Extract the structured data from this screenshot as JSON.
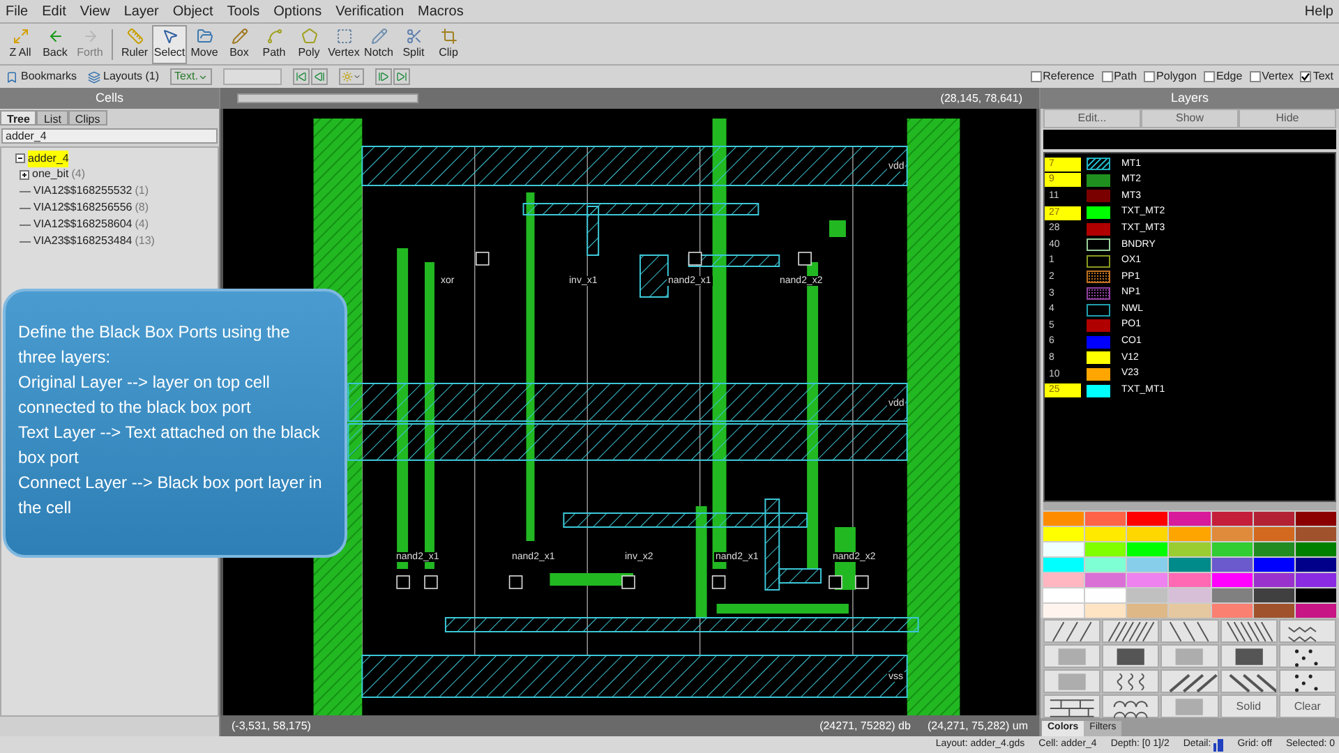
{
  "menu": [
    {
      "label": "File"
    },
    {
      "label": "Edit"
    },
    {
      "label": "View"
    },
    {
      "label": "Layer"
    },
    {
      "label": "Object"
    },
    {
      "label": "Tools"
    },
    {
      "label": "Options"
    },
    {
      "label": "Verification"
    },
    {
      "label": "Macros"
    }
  ],
  "help": "Help",
  "toolbar": [
    {
      "label": "Z All",
      "selected": false,
      "disabled": false
    },
    {
      "label": "Back",
      "selected": false,
      "disabled": false
    },
    {
      "label": "Forth",
      "selected": false,
      "disabled": true
    },
    {
      "label": "Ruler",
      "selected": false,
      "disabled": false
    },
    {
      "label": "Select",
      "selected": true,
      "disabled": false
    },
    {
      "label": "Move",
      "selected": false,
      "disabled": false
    },
    {
      "label": "Box",
      "selected": false,
      "disabled": false
    },
    {
      "label": "Path",
      "selected": false,
      "disabled": false
    },
    {
      "label": "Poly",
      "selected": false,
      "disabled": false
    },
    {
      "label": "Vertex",
      "selected": false,
      "disabled": false
    },
    {
      "label": "Notch",
      "selected": false,
      "disabled": false
    },
    {
      "label": "Split",
      "selected": false,
      "disabled": false
    },
    {
      "label": "Clip",
      "selected": false,
      "disabled": false
    }
  ],
  "subtoolbar": {
    "bookmarks": "Bookmarks",
    "layouts": "Layouts (1)",
    "text_mode": "Text."
  },
  "filters": [
    {
      "label": "Reference",
      "checked": false
    },
    {
      "label": "Path",
      "checked": false
    },
    {
      "label": "Polygon",
      "checked": false
    },
    {
      "label": "Edge",
      "checked": false
    },
    {
      "label": "Vertex",
      "checked": false
    },
    {
      "label": "Text",
      "checked": true
    }
  ],
  "cells": {
    "title": "Cells",
    "tabs": [
      {
        "label": "Tree",
        "selected": true
      },
      {
        "label": "List",
        "selected": false
      },
      {
        "label": "Clips",
        "selected": false
      }
    ],
    "field": "adder_4",
    "tree": [
      {
        "name": "adder_4",
        "selected": true,
        "expanded": true,
        "children": [
          {
            "name": "one_bit",
            "count": "(4)",
            "selected": false,
            "expanded": false
          },
          {
            "name": "VIA12$$168255532",
            "count": "(1)",
            "selected": false
          },
          {
            "name": "VIA12$$168256556",
            "count": "(8)",
            "selected": false
          },
          {
            "name": "VIA12$$168258604",
            "count": "(4)",
            "selected": false
          },
          {
            "name": "VIA23$$168253484",
            "count": "(13)",
            "selected": false
          }
        ]
      }
    ]
  },
  "canvas": {
    "coords": "(28,145, 78,641)",
    "labels": [
      {
        "text": "xor"
      },
      {
        "text": "inv_x1"
      },
      {
        "text": "nand2_x1"
      },
      {
        "text": "nand2_x2"
      },
      {
        "text": "nand2_x1"
      },
      {
        "text": "nand2_x1"
      },
      {
        "text": "inv_x2"
      },
      {
        "text": "nand2_x1"
      },
      {
        "text": "nand2_x2"
      },
      {
        "text": "vdd"
      },
      {
        "text": "vdd"
      },
      {
        "text": "vss"
      }
    ],
    "status": [
      "(-3,531, 58,175)",
      "(24271, 75282) db",
      "(24,271, 75,282) um"
    ]
  },
  "callout": {
    "paragraphs": [
      "Define the Black Box Ports using the three layers:",
      "Original Layer --> layer on top cell connected to the black box port",
      "Text Layer --> Text attached on the black box port",
      "Connect Layer --> Black box port layer in the cell"
    ]
  },
  "layers": {
    "title": "Layers",
    "buttons": [
      "Edit...",
      "Show",
      "Hide"
    ],
    "items": [
      {
        "number": "7",
        "highlighted": true,
        "color": "#20b0c0",
        "kind": "hatched",
        "name": "MT1"
      },
      {
        "number": "9",
        "highlighted": true,
        "color": "#1f8f1f",
        "kind": "solid",
        "name": "MT2"
      },
      {
        "number": "11",
        "highlighted": false,
        "color": "#7a0000",
        "kind": "solid",
        "name": "MT3"
      },
      {
        "number": "27",
        "highlighted": true,
        "color": "#00ff00",
        "kind": "solid",
        "name": "TXT_MT2"
      },
      {
        "number": "28",
        "highlighted": false,
        "color": "#b00000",
        "kind": "solid",
        "name": "TXT_MT3"
      },
      {
        "number": "40",
        "highlighted": false,
        "color": "#9acd9a",
        "kind": "outline",
        "name": "BNDRY"
      },
      {
        "number": "1",
        "highlighted": false,
        "color": "#8a9a20",
        "kind": "outline",
        "name": "OX1"
      },
      {
        "number": "2",
        "highlighted": false,
        "color": "#c07020",
        "kind": "dotted",
        "name": "PP1"
      },
      {
        "number": "3",
        "highlighted": false,
        "color": "#9040a0",
        "kind": "dotted",
        "name": "NP1"
      },
      {
        "number": "4",
        "highlighted": false,
        "color": "#20a0b0",
        "kind": "outline",
        "name": "NWL"
      },
      {
        "number": "5",
        "highlighted": false,
        "color": "#b00000",
        "kind": "solid",
        "name": "PO1"
      },
      {
        "number": "6",
        "highlighted": false,
        "color": "#0000ff",
        "kind": "solid",
        "name": "CO1"
      },
      {
        "number": "8",
        "highlighted": false,
        "color": "#ffff00",
        "kind": "solid",
        "name": "V12"
      },
      {
        "number": "10",
        "highlighted": false,
        "color": "#ffa500",
        "kind": "solid",
        "name": "V23"
      },
      {
        "number": "25",
        "highlighted": true,
        "color": "#00ffff",
        "kind": "solid",
        "name": "TXT_MT1"
      }
    ]
  },
  "palette": [
    {
      "color": "#ff8c00"
    },
    {
      "color": "#ff6347"
    },
    {
      "color": "#ff0000"
    },
    {
      "color": "#d81b9b"
    },
    {
      "color": "#c41e3a"
    },
    {
      "color": "#b22234"
    },
    {
      "color": "#8b0000"
    },
    {
      "color": "#ffff00"
    },
    {
      "color": "#ffea00"
    },
    {
      "color": "#ffd700"
    },
    {
      "color": "#ffa500"
    },
    {
      "color": "#e08a3c"
    },
    {
      "color": "#d2691e"
    },
    {
      "color": "#a0522d"
    },
    {
      "color": "#f0ffff"
    },
    {
      "color": "#7fff00"
    },
    {
      "color": "#00ff00"
    },
    {
      "color": "#9acd32"
    },
    {
      "color": "#32cd32"
    },
    {
      "color": "#228b22"
    },
    {
      "color": "#008000"
    },
    {
      "color": "#00ffff"
    },
    {
      "color": "#7fffd4"
    },
    {
      "color": "#87ceeb"
    },
    {
      "color": "#008b8b"
    },
    {
      "color": "#6a5acd"
    },
    {
      "color": "#0000ff"
    },
    {
      "color": "#00008b"
    },
    {
      "color": "#ffb6c1"
    },
    {
      "color": "#da70d6"
    },
    {
      "color": "#ee82ee"
    },
    {
      "color": "#ff69b4"
    },
    {
      "color": "#ff00ff"
    },
    {
      "color": "#9932cc"
    },
    {
      "color": "#8a2be2"
    },
    {
      "color": "#ffffff"
    },
    {
      "color": "#fefefe"
    },
    {
      "color": "#c0c0c0"
    },
    {
      "color": "#d8bfd8"
    },
    {
      "color": "#808080"
    },
    {
      "color": "#404040"
    },
    {
      "color": "#000000"
    },
    {
      "color": "#fff5ee"
    },
    {
      "color": "#ffe4c4"
    },
    {
      "color": "#deb887"
    },
    {
      "color": "#e6c8a0"
    },
    {
      "color": "#fa8072"
    },
    {
      "color": "#a0522d"
    },
    {
      "color": "#c71585"
    }
  ],
  "patterns": [
    {
      "kind": "slash"
    },
    {
      "kind": "slash-dense"
    },
    {
      "kind": "backslash"
    },
    {
      "kind": "backslash-dense"
    },
    {
      "kind": "chevron"
    },
    {
      "kind": "fine"
    },
    {
      "kind": "dark"
    },
    {
      "kind": "fine"
    },
    {
      "kind": "dark"
    },
    {
      "kind": "sparse-dots"
    },
    {
      "kind": "fine"
    },
    {
      "kind": "wave"
    },
    {
      "kind": "slash-thick"
    },
    {
      "kind": "backslash-thick"
    },
    {
      "kind": "sparse-dots"
    },
    {
      "kind": "brick"
    },
    {
      "kind": "scales"
    },
    {
      "kind": "fine"
    },
    {
      "kind": "text",
      "label": "Solid"
    },
    {
      "kind": "text",
      "label": "Clear"
    }
  ],
  "bottom_tabs": [
    {
      "label": "Colors",
      "selected": true
    },
    {
      "label": "Filters",
      "selected": false
    }
  ],
  "status": [
    {
      "kind": "text",
      "text": "Layout: adder_4.gds"
    },
    {
      "kind": "text",
      "text": "Cell: adder_4"
    },
    {
      "kind": "text",
      "text": "Depth: [0 1]/2"
    },
    {
      "kind": "detail",
      "text": "Detail:"
    },
    {
      "kind": "text",
      "text": "Grid: off"
    },
    {
      "kind": "text",
      "text": "Selected: 0"
    }
  ]
}
